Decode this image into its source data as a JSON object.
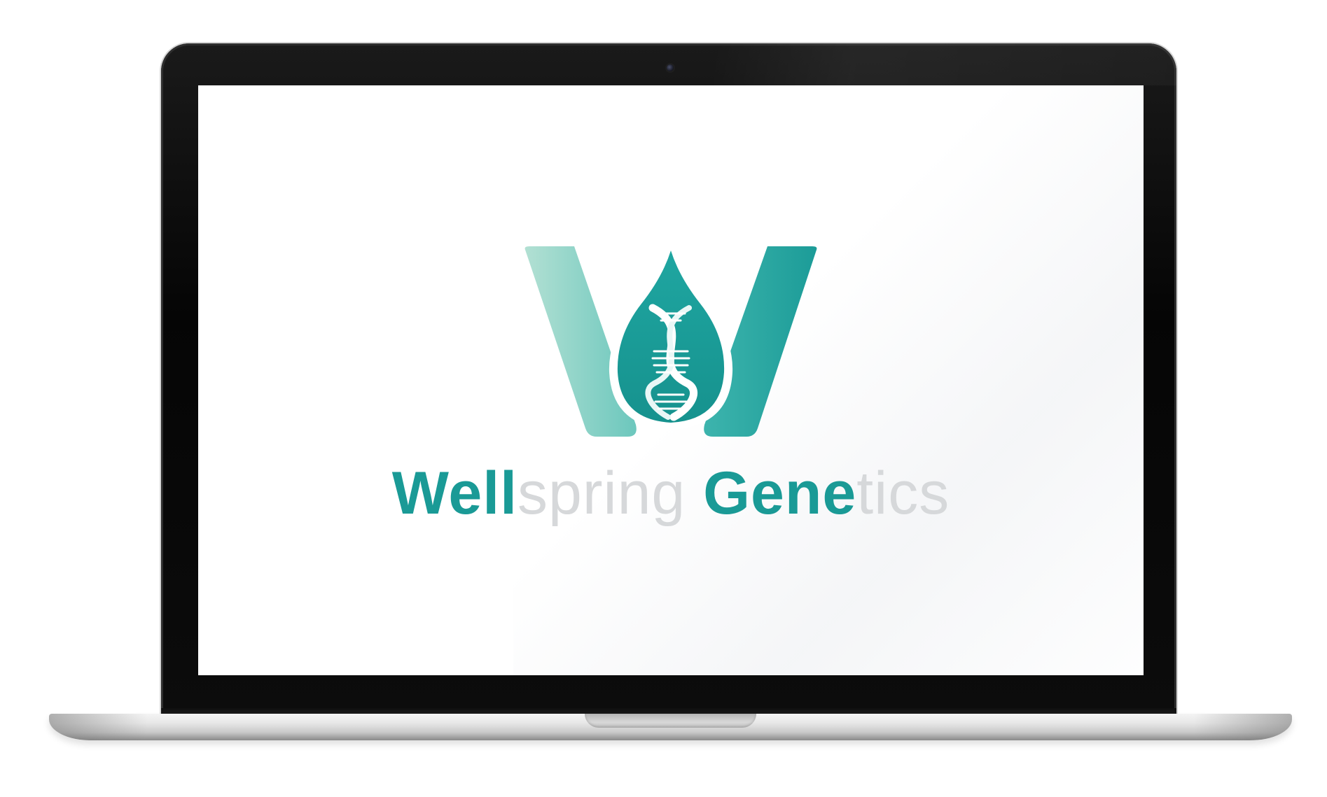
{
  "logo": {
    "wordmark_parts": [
      {
        "text": "Well",
        "style": "bold"
      },
      {
        "text": "spring",
        "style": "light"
      },
      {
        "text": " ",
        "style": "light"
      },
      {
        "text": "Gene",
        "style": "bold"
      },
      {
        "text": "tics",
        "style": "light"
      }
    ],
    "mark_icon": "w-with-dna-droplet-icon"
  },
  "colors": {
    "brand_teal": "#1a9a96",
    "brand_teal_light": "#a8dccf",
    "wordmark_light_gray": "#d6d8da",
    "bezel_black": "#050505",
    "aluminum": "#e7e7e7"
  }
}
